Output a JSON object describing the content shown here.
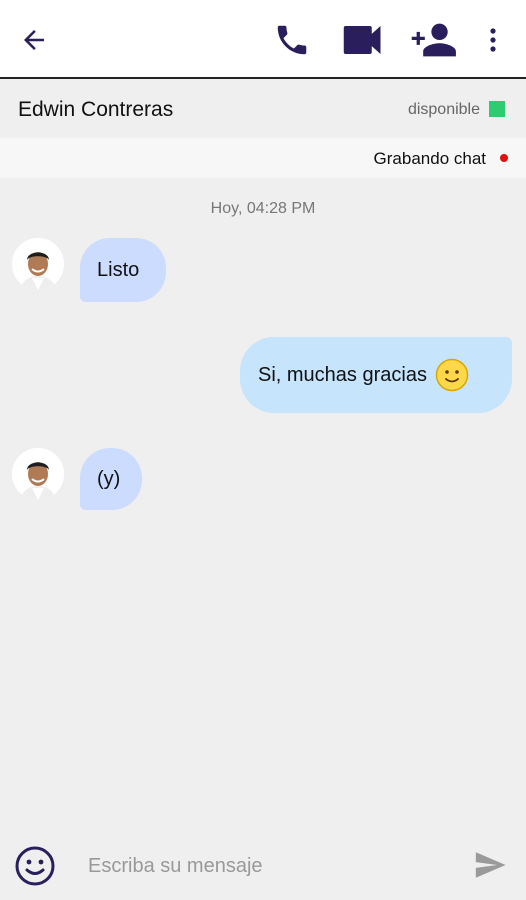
{
  "colors": {
    "accent": "#2a1e5c",
    "incoming_bubble": "#cbdcff",
    "outgoing_bubble": "#c6e4fb",
    "status_available": "#2ecc71",
    "recording_dot": "#e01010"
  },
  "toolbar": {
    "icons": [
      "back-arrow-icon",
      "phone-icon",
      "video-camera-icon",
      "add-user-icon",
      "more-vertical-icon"
    ]
  },
  "contact": {
    "name": "Edwin Contreras",
    "status": "disponible"
  },
  "recording": {
    "label": "Grabando chat"
  },
  "chat": {
    "timestamp": "Hoy, 04:28 PM",
    "messages": [
      {
        "direction": "incoming",
        "text": "Listo"
      },
      {
        "direction": "outgoing",
        "text": "Si, muchas gracias",
        "emoji": "slight-smile-emoji"
      },
      {
        "direction": "incoming",
        "text": "(y)"
      }
    ]
  },
  "composer": {
    "placeholder": "Escriba su mensaje",
    "value": "",
    "icons": [
      "smiley-icon",
      "send-icon"
    ]
  }
}
